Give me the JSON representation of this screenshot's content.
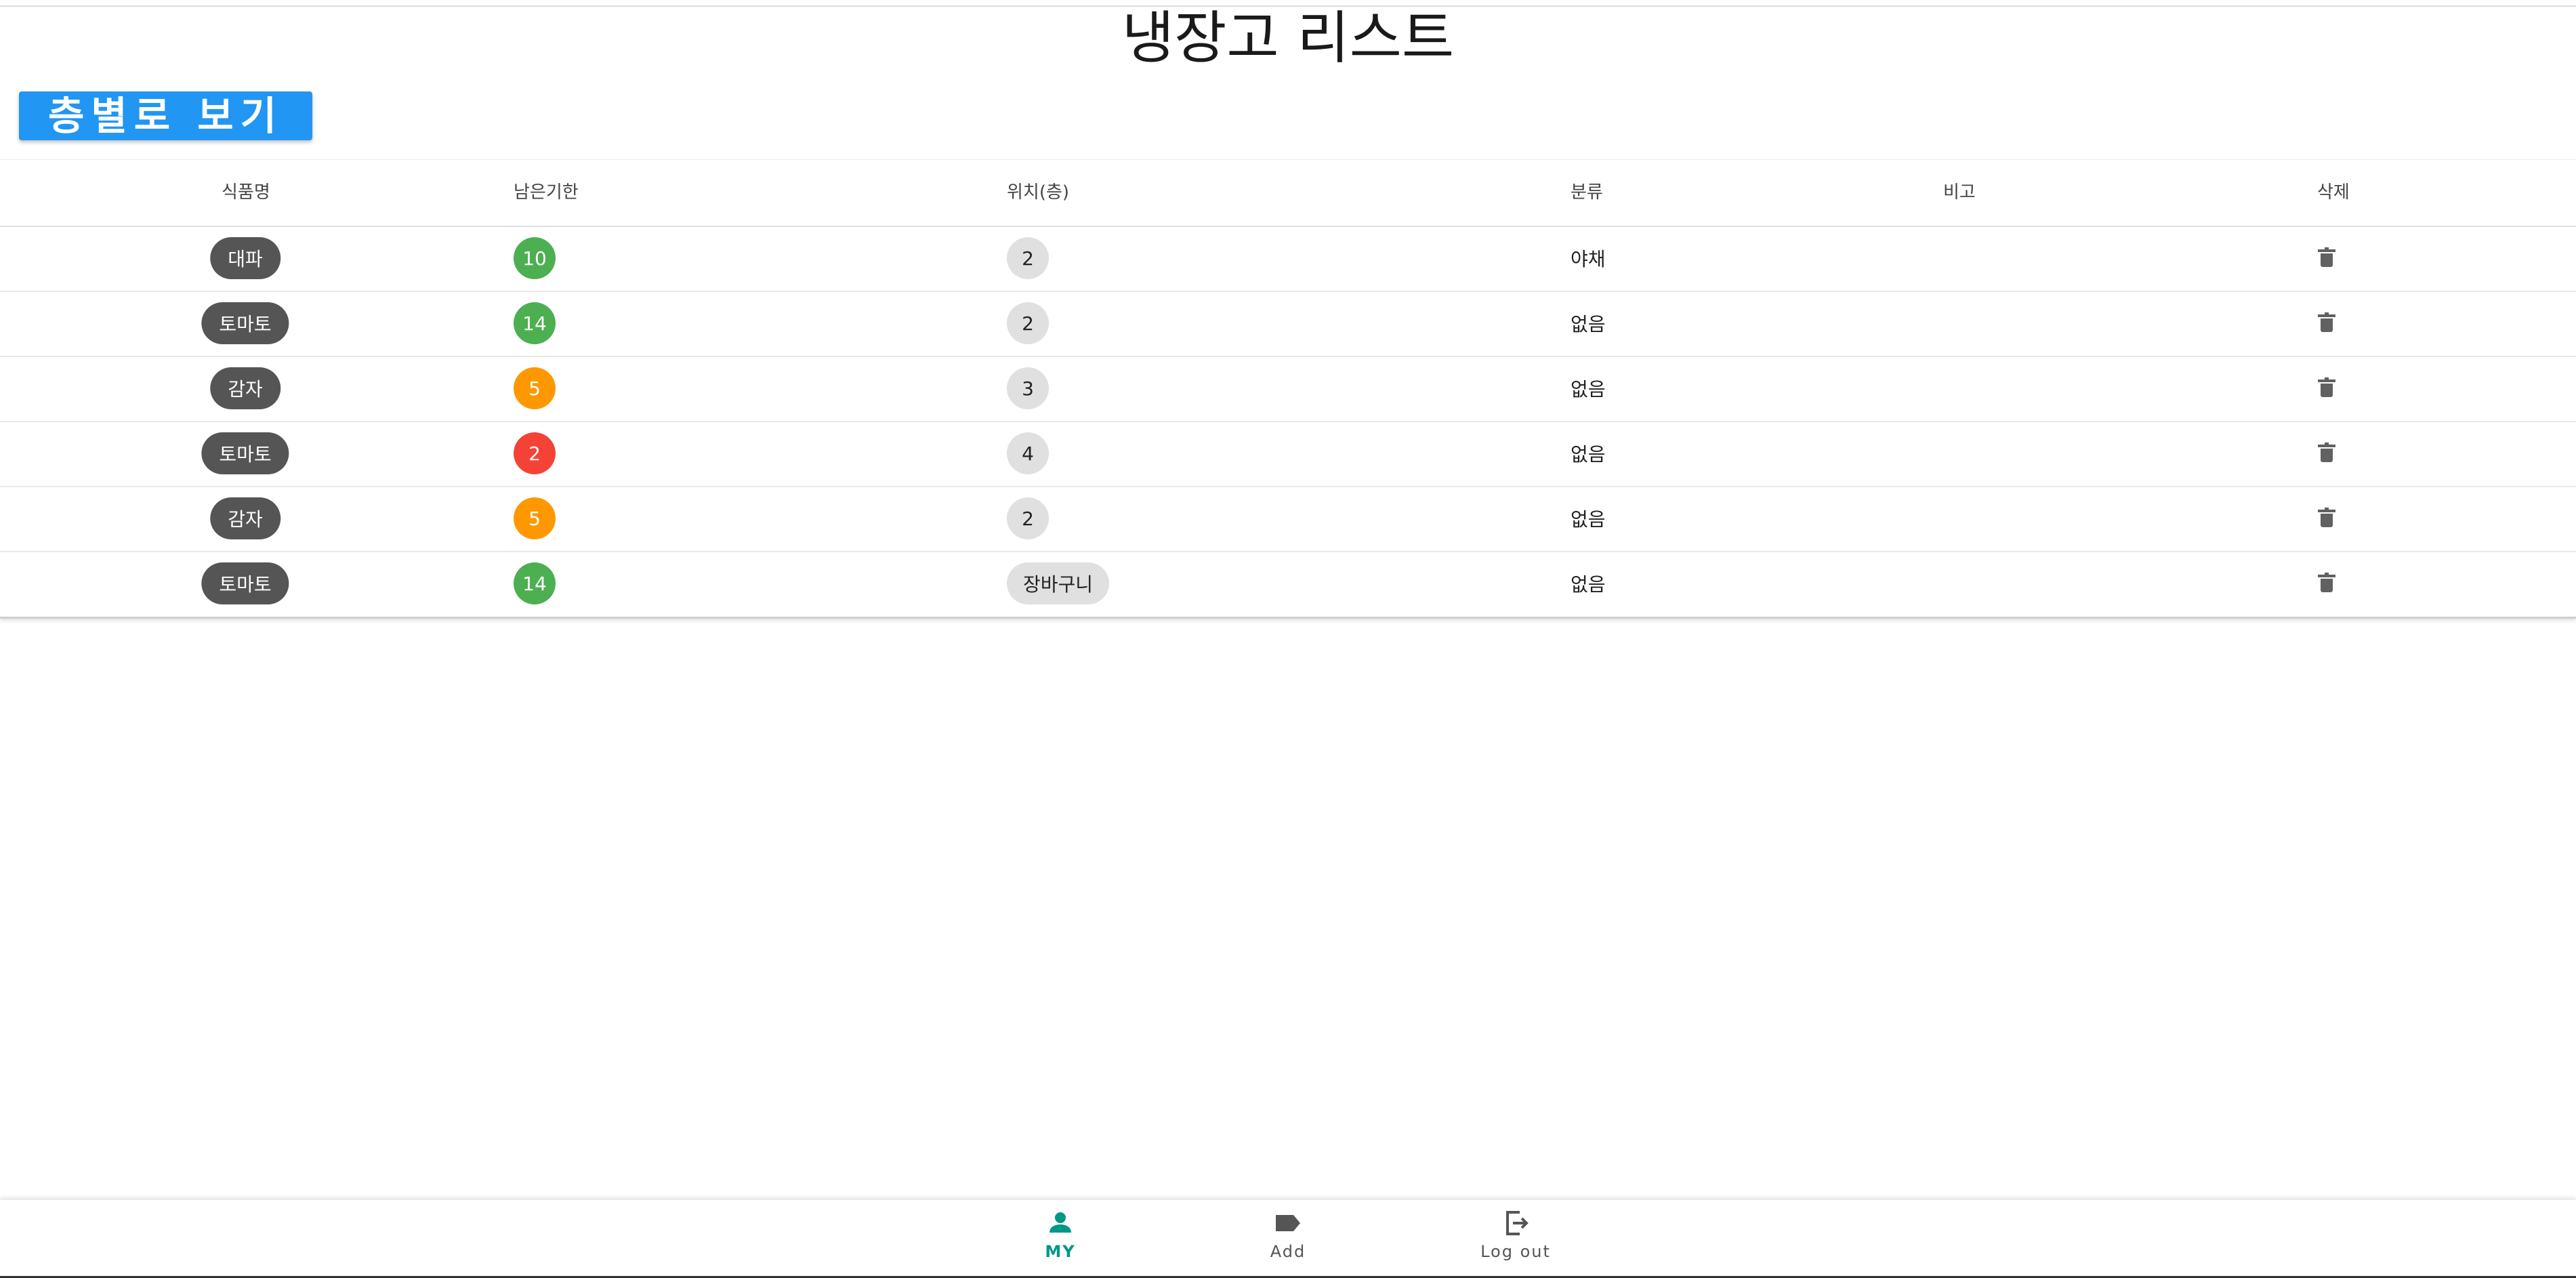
{
  "page": {
    "title": "냉장고 리스트"
  },
  "floor_button": {
    "label": "층별로 보기"
  },
  "table": {
    "headers": {
      "name": "식품명",
      "remaining": "남은기한",
      "location": "위치(층)",
      "category": "분류",
      "note": "비고",
      "delete": "삭제"
    },
    "rows": [
      {
        "name": "대파",
        "remaining": "10",
        "location": "2",
        "category": "야채",
        "note": ""
      },
      {
        "name": "토마토",
        "remaining": "14",
        "location": "2",
        "category": "없음",
        "note": ""
      },
      {
        "name": "감자",
        "remaining": "5",
        "location": "3",
        "category": "없음",
        "note": ""
      },
      {
        "name": "토마토",
        "remaining": "2",
        "location": "4",
        "category": "없음",
        "note": ""
      },
      {
        "name": "감자",
        "remaining": "5",
        "location": "2",
        "category": "없음",
        "note": ""
      },
      {
        "name": "토마토",
        "remaining": "14",
        "location": "장바구니",
        "category": "없음",
        "note": ""
      }
    ]
  },
  "colors": {
    "days_green": "#4caf50",
    "days_orange": "#ff9800",
    "days_red": "#f44336",
    "primary": "#2196f3",
    "nav_active": "#009688"
  },
  "bottom_nav": {
    "items": [
      {
        "label": "MY",
        "icon": "person-icon",
        "active": true
      },
      {
        "label": "Add",
        "icon": "label-icon",
        "active": false
      },
      {
        "label": "Log out",
        "icon": "logout-icon",
        "active": false
      }
    ]
  }
}
